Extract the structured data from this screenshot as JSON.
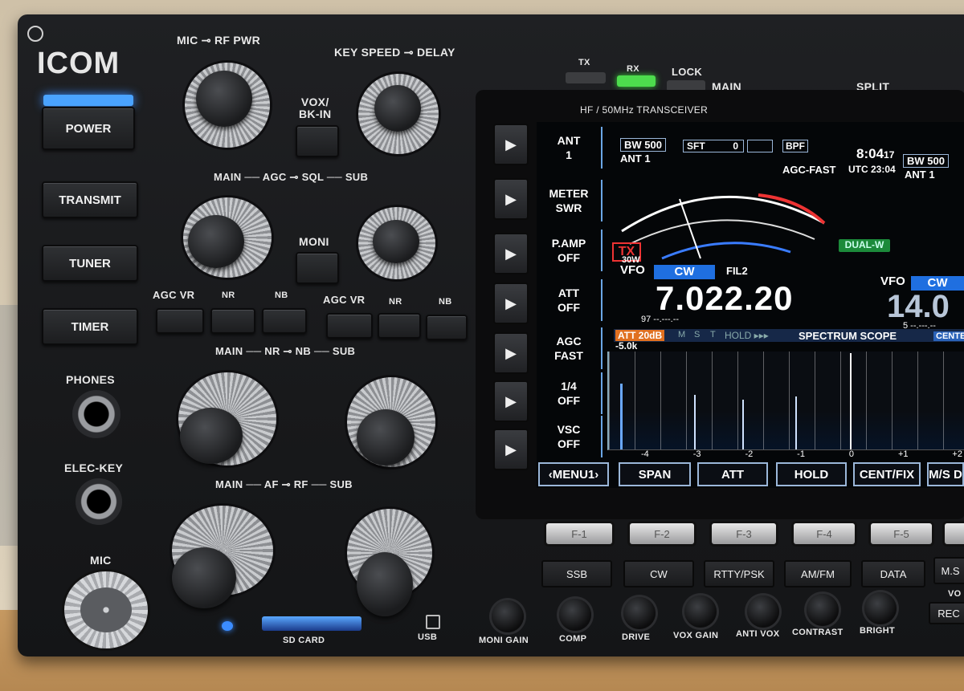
{
  "brand": {
    "logo": "ICOM"
  },
  "left_panel": {
    "power": "POWER",
    "transmit": "TRANSMIT",
    "tuner": "TUNER",
    "timer": "TIMER",
    "phones": "PHONES",
    "elec_key": "ELEC-KEY",
    "mic": "MIC"
  },
  "knob_labels": {
    "mic_rf": "MIC ⊸ RF PWR",
    "key_delay": "KEY SPEED ⊸ DELAY",
    "vox": "VOX/\nBK-IN",
    "agc_sql": "MAIN ── AGC ⊸ SQL ── SUB",
    "moni": "MONI",
    "row_left": [
      "AGC VR",
      "NR",
      "NB"
    ],
    "row_right": [
      "AGC VR",
      "NR",
      "NB"
    ],
    "nr_nb": "MAIN ── NR ⊸ NB ── SUB",
    "af_rf": "MAIN ── AF ⊸ RF ── SUB",
    "sd": "SD CARD",
    "usb": "USB"
  },
  "indicators": {
    "tx": "TX",
    "rx": "RX",
    "lock": "LOCK",
    "main": "MAIN",
    "split": "SPLIT",
    "model": "HF / 50MHz TRANSCEIVER"
  },
  "screen": {
    "side": [
      {
        "a": "ANT",
        "b": "1"
      },
      {
        "a": "METER",
        "b": "SWR"
      },
      {
        "a": "P.AMP",
        "b": "OFF"
      },
      {
        "a": "ATT",
        "b": "OFF"
      },
      {
        "a": "AGC",
        "b": "FAST"
      },
      {
        "a": "1/4",
        "b": "OFF"
      },
      {
        "a": "VSC",
        "b": "OFF"
      }
    ],
    "bw": "BW 500",
    "sft": "SFT",
    "sft_val": "0",
    "bpf": "BPF",
    "ant": "ANT 1",
    "agc": "AGC-FAST",
    "time": "8:04",
    "time_sec": "17",
    "utc": "UTC 23:04",
    "bw2": "BW 500",
    "ant2": "ANT 1",
    "tx": "TX",
    "power": "30W",
    "vfo": "VFO",
    "mode": "CW",
    "fil": "FIL2",
    "freq": "7.022.20",
    "freq_sub": "97 --.---.--",
    "vfo2": "VFO",
    "mode2": "CW",
    "freq2": "14.0",
    "freq2_sub": "5 --.---.--",
    "dualw": "DUAL-W",
    "att_tag": "ATT 20dB",
    "scope_flags": [
      "M",
      "S",
      "T"
    ],
    "hold": "HOLD ▸▸▸",
    "scope": "SPECTRUM SCOPE",
    "center": "CENTER",
    "span_left": "-5.0k",
    "scale": [
      "-4",
      "-3",
      "-2",
      "-1",
      "0",
      "+1",
      "+2"
    ],
    "menu": [
      "‹MENU1›",
      "SPAN",
      "ATT",
      "HOLD",
      "CENT/FIX",
      "M/S D"
    ]
  },
  "fkeys": [
    "F-1",
    "F-2",
    "F-3",
    "F-4",
    "F-5"
  ],
  "modes": [
    "SSB",
    "CW",
    "RTTY/PSK",
    "AM/FM",
    "DATA",
    "M.S"
  ],
  "small_knobs": [
    "MONI GAIN",
    "COMP",
    "DRIVE",
    "VOX GAIN",
    "ANTI VOX",
    "CONTRAST",
    "BRIGHT"
  ],
  "misc": {
    "rec": "REC",
    "vo": "VO"
  }
}
